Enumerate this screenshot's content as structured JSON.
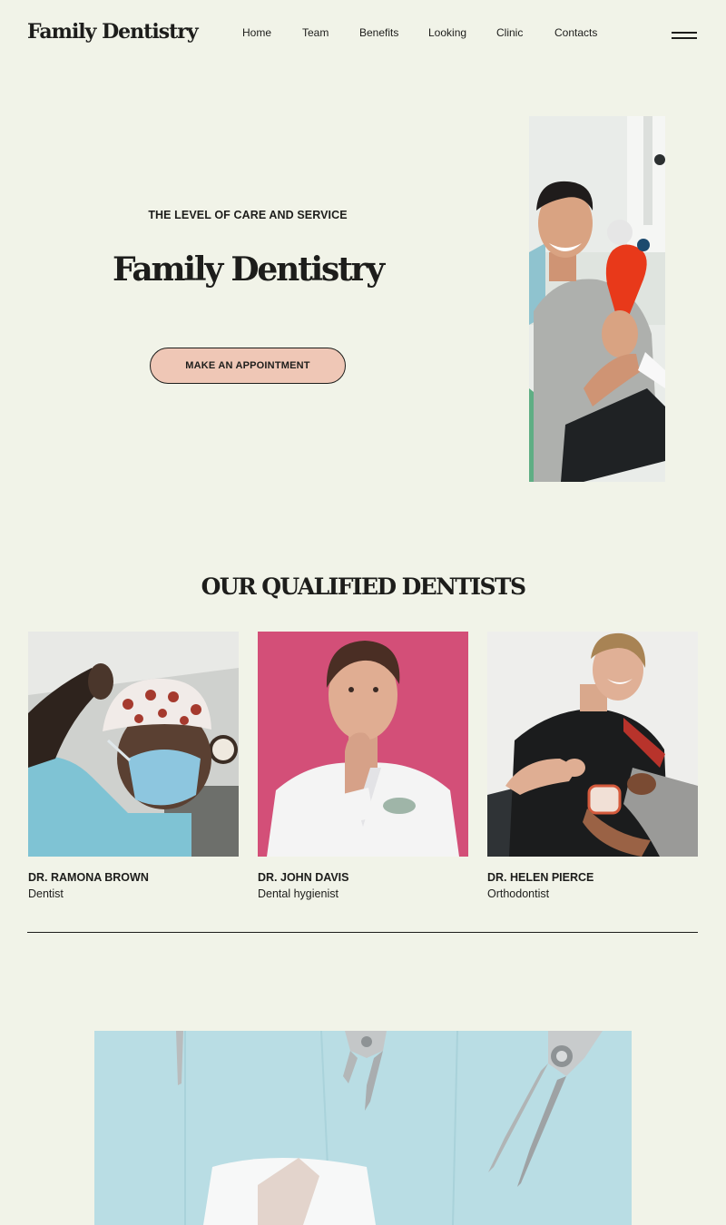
{
  "brand": {
    "logo": "Family Dentistry"
  },
  "nav": {
    "items": [
      {
        "label": "Home"
      },
      {
        "label": "Team"
      },
      {
        "label": "Benefits"
      },
      {
        "label": "Looking"
      },
      {
        "label": "Clinic"
      },
      {
        "label": "Contacts"
      }
    ]
  },
  "hero": {
    "eyebrow": "THE LEVEL OF CARE AND SERVICE",
    "title": "Family Dentistry",
    "cta_label": "MAKE AN APPOINTMENT"
  },
  "team": {
    "heading": "OUR QUALIFIED DENTISTS",
    "members": [
      {
        "name": "DR. RAMONA BROWN",
        "role": "Dentist"
      },
      {
        "name": "DR. JOHN DAVIS",
        "role": "Dental hygienist"
      },
      {
        "name": "DR. HELEN PIERCE",
        "role": "Orthodontist"
      }
    ]
  },
  "colors": {
    "background": "#f1f3e8",
    "text": "#1d1d1b",
    "cta_fill": "#efc7b6",
    "team_photo_2_bg": "#d34f78",
    "tools_bg": "#b9dde4"
  }
}
